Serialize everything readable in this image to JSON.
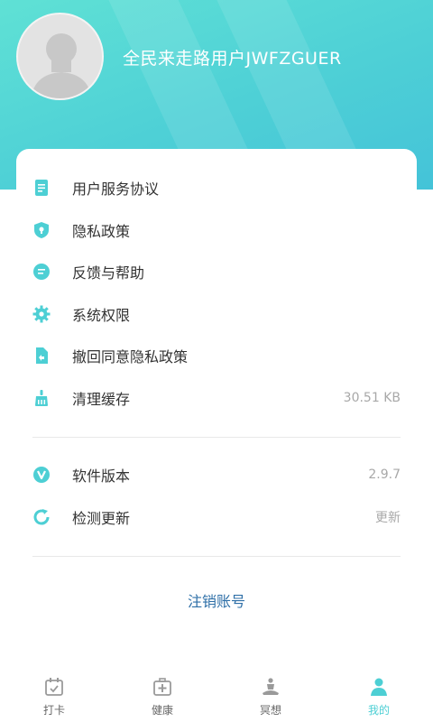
{
  "profile": {
    "username": "全民来走路用户JWFZGUER"
  },
  "menu": [
    {
      "label": "用户服务协议",
      "value": "",
      "icon": "document-icon"
    },
    {
      "label": "隐私政策",
      "value": "",
      "icon": "shield-lock-icon"
    },
    {
      "label": "反馈与帮助",
      "value": "",
      "icon": "feedback-icon"
    },
    {
      "label": "系统权限",
      "value": "",
      "icon": "gear-icon"
    },
    {
      "label": "撤回同意隐私政策",
      "value": "",
      "icon": "undo-file-icon"
    },
    {
      "label": "清理缓存",
      "value": "30.51 KB",
      "icon": "broom-icon"
    }
  ],
  "menu2": [
    {
      "label": "软件版本",
      "value": "2.9.7",
      "icon": "version-icon"
    },
    {
      "label": "检测更新",
      "value": "更新",
      "icon": "refresh-icon"
    }
  ],
  "logout_label": "注销账号",
  "tabs": [
    {
      "label": "打卡",
      "icon": "calendar-check-icon",
      "active": false
    },
    {
      "label": "健康",
      "icon": "medical-kit-icon",
      "active": false
    },
    {
      "label": "冥想",
      "icon": "meditation-icon",
      "active": false
    },
    {
      "label": "我的",
      "icon": "person-icon",
      "active": true
    }
  ],
  "colors": {
    "accent": "#4dcfd4",
    "header_gradient_start": "#5fe1d5",
    "header_gradient_end": "#44c3d8",
    "link": "#2e6fa7"
  }
}
